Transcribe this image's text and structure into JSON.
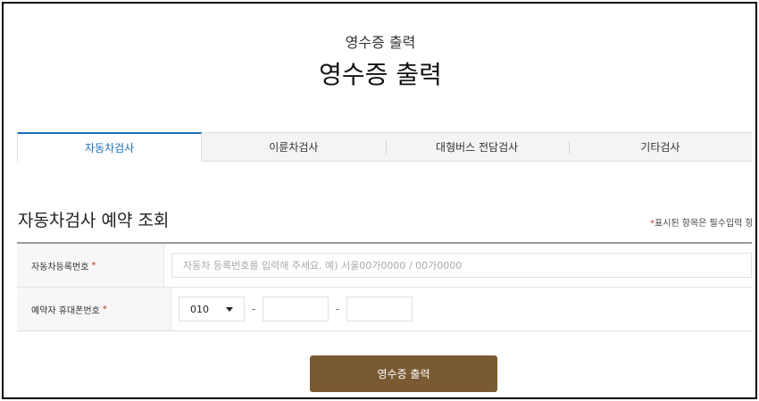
{
  "header": {
    "small_title": "영수증 출력",
    "big_title": "영수증 출력"
  },
  "tabs": [
    {
      "label": "자동차검사",
      "active": true
    },
    {
      "label": "이륜차검사",
      "active": false
    },
    {
      "label": "대형버스 전담검사",
      "active": false
    },
    {
      "label": "기타검사",
      "active": false
    }
  ],
  "section": {
    "title": "자동차검사 예약 조회",
    "required_note_star": "*",
    "required_note": "표시된 항목은 필수입력 항"
  },
  "form": {
    "plate_label": "자동차등록번호",
    "plate_placeholder": "자동차 등록번호를 입력해 주세요. 예) 서울00가0000 / 00가0000",
    "phone_label": "예약자 휴대폰번호",
    "phone_prefix": "010",
    "dash": "-",
    "required_star": "*"
  },
  "actions": {
    "print_label": "영수증 출력"
  },
  "colors": {
    "accent_tab": "#1a6fb5",
    "button": "#7a5a32",
    "required": "#c0392b"
  }
}
